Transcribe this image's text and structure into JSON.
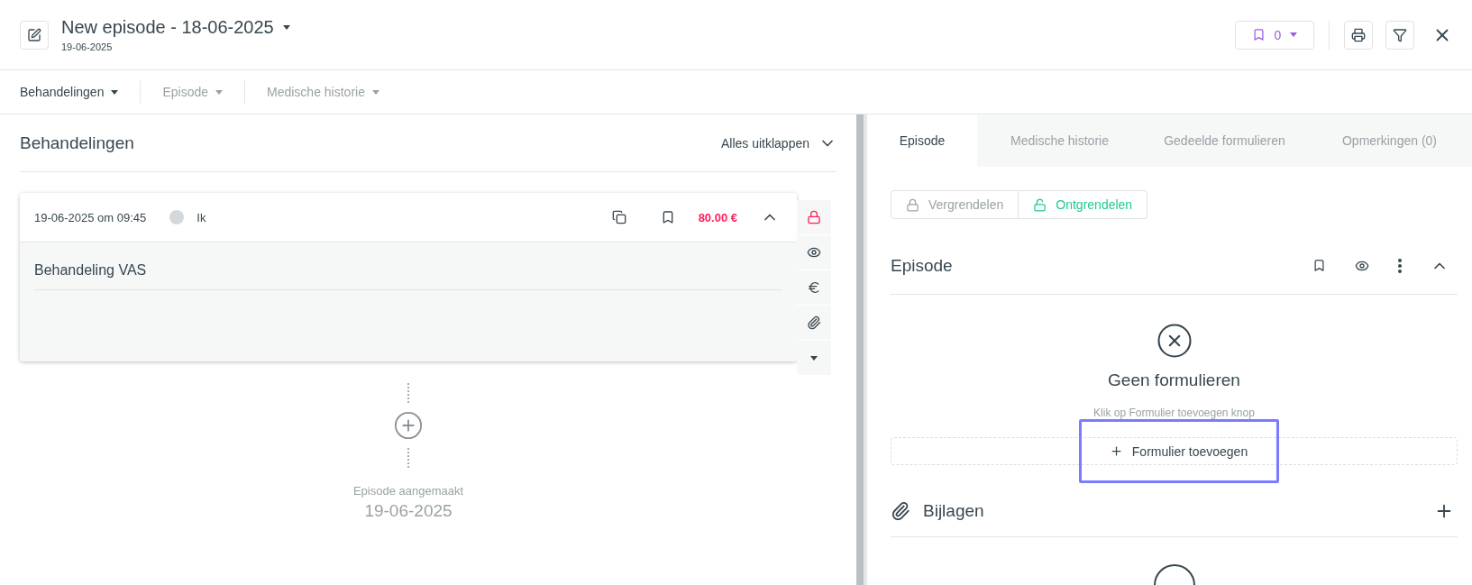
{
  "header": {
    "title": "New episode - 18-06-2025",
    "subtitle": "19-06-2025",
    "bookmark_count": "0"
  },
  "nav": [
    {
      "label": "Behandelingen",
      "selected": true
    },
    {
      "label": "Episode",
      "selected": false
    },
    {
      "label": "Medische historie",
      "selected": false
    }
  ],
  "left": {
    "title": "Behandelingen",
    "expand_all": "Alles uitklappen",
    "treatment": {
      "datetime": "19-06-2025 om 09:45",
      "user": "Ik",
      "price": "80.00 €",
      "name": "Behandeling VAS",
      "locked": true
    },
    "timeline": {
      "label": "Episode aangemaakt",
      "date": "19-06-2025"
    }
  },
  "tabs": [
    {
      "label": "Episode",
      "selected": true
    },
    {
      "label": "Medische historie",
      "selected": false
    },
    {
      "label": "Gedeelde formulieren",
      "selected": false
    },
    {
      "label": "Opmerkingen (0)",
      "selected": false
    }
  ],
  "lock_toggle": [
    {
      "label": "Vergrendelen",
      "selected": false
    },
    {
      "label": "Ontgrendelen",
      "selected": true
    }
  ],
  "episode_section": {
    "title": "Episode",
    "empty_title": "Geen formulieren",
    "empty_hint": "Klik op Formulier toevoegen knop",
    "add_button": {
      "label": "Formulier toevoegen",
      "highlighted": true
    }
  },
  "attachments": {
    "title": "Bijlagen"
  }
}
